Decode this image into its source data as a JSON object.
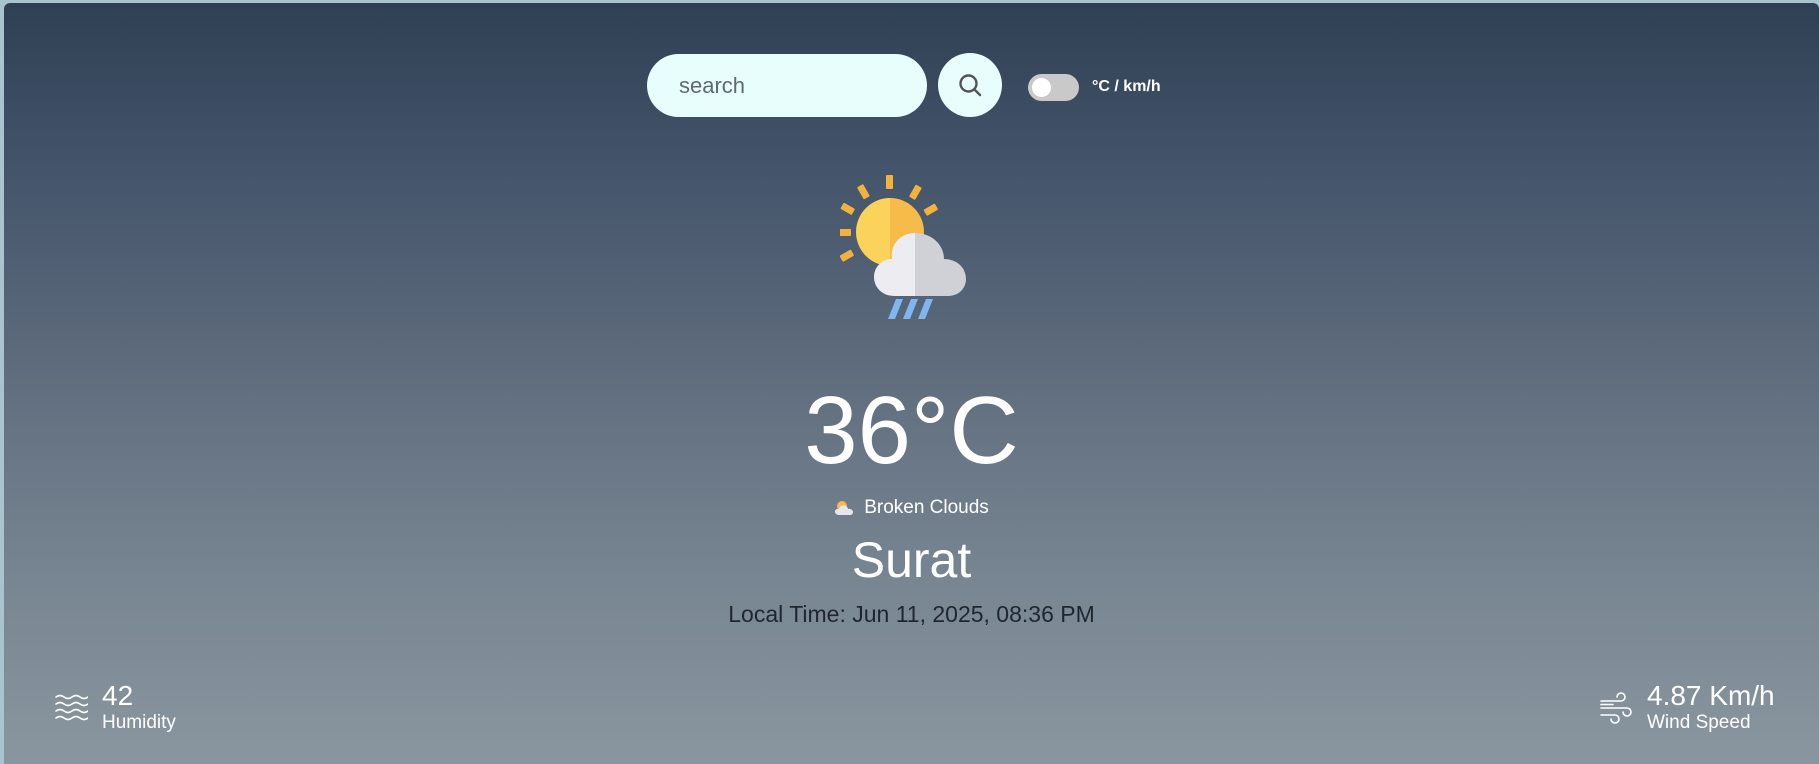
{
  "search": {
    "placeholder": "search"
  },
  "toggle": {
    "label": "°C / km/h"
  },
  "weather": {
    "icon": "sun-cloud-rain-icon",
    "temperature": "36°C",
    "condition_icon": "cloud-sun-small-icon",
    "condition": "Broken Clouds",
    "city": "Surat",
    "local_time": "Local Time: Jun 11, 2025, 08:36 PM"
  },
  "stats": {
    "humidity": {
      "icon": "waves-icon",
      "value": "42",
      "label": "Humidity"
    },
    "wind": {
      "icon": "wind-icon",
      "value": "4.87 Km/h",
      "label": "Wind Speed"
    }
  },
  "colors": {
    "gradient_top": "#2f4054",
    "gradient_bottom": "#8a969f",
    "input_bg": "#e8fefc",
    "toggle_off": "#c9c9c9"
  }
}
